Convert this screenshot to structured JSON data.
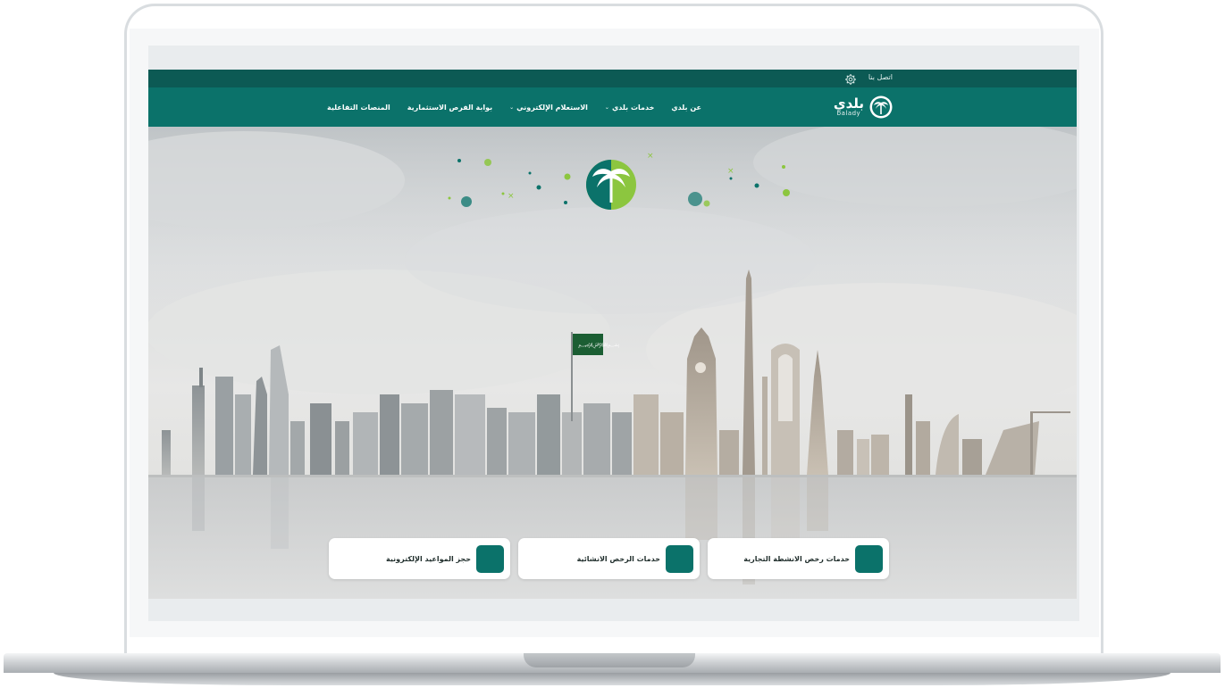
{
  "topbar": {
    "contact_label": "اتصل بنا",
    "settings_icon": "gear-icon"
  },
  "logo": {
    "arabic": "بلدي",
    "latin": "balady",
    "icon": "palm-tree-logo-icon"
  },
  "nav": {
    "items": [
      {
        "label": "عن بلدي",
        "has_dropdown": false
      },
      {
        "label": "خدمات بلدي",
        "has_dropdown": true
      },
      {
        "label": "الاستعلام الإلكتروني",
        "has_dropdown": true
      },
      {
        "label": "بوابة الفرص الاستثمارية",
        "has_dropdown": false
      },
      {
        "label": "المنصات التفاعلية",
        "has_dropdown": false
      }
    ],
    "dropdown_icon": "chevron-down-icon"
  },
  "hero": {
    "emblem_icon": "palm-tree-emblem-icon",
    "background": "city-skyline"
  },
  "services": [
    {
      "label": "خدمات رخص الانشطة التجارية",
      "icon": "license-seal-icon"
    },
    {
      "label": "خدمات الرخص الانشائية",
      "icon": "building-icon"
    },
    {
      "label": "حجز المواعيد الإلكترونية",
      "icon": "calendar-icon"
    }
  ],
  "colors": {
    "topbar": "#0c5a54",
    "navbar": "#0b726a",
    "accent_green": "#8cc63f",
    "card_icon_bg": "#0b726a"
  }
}
